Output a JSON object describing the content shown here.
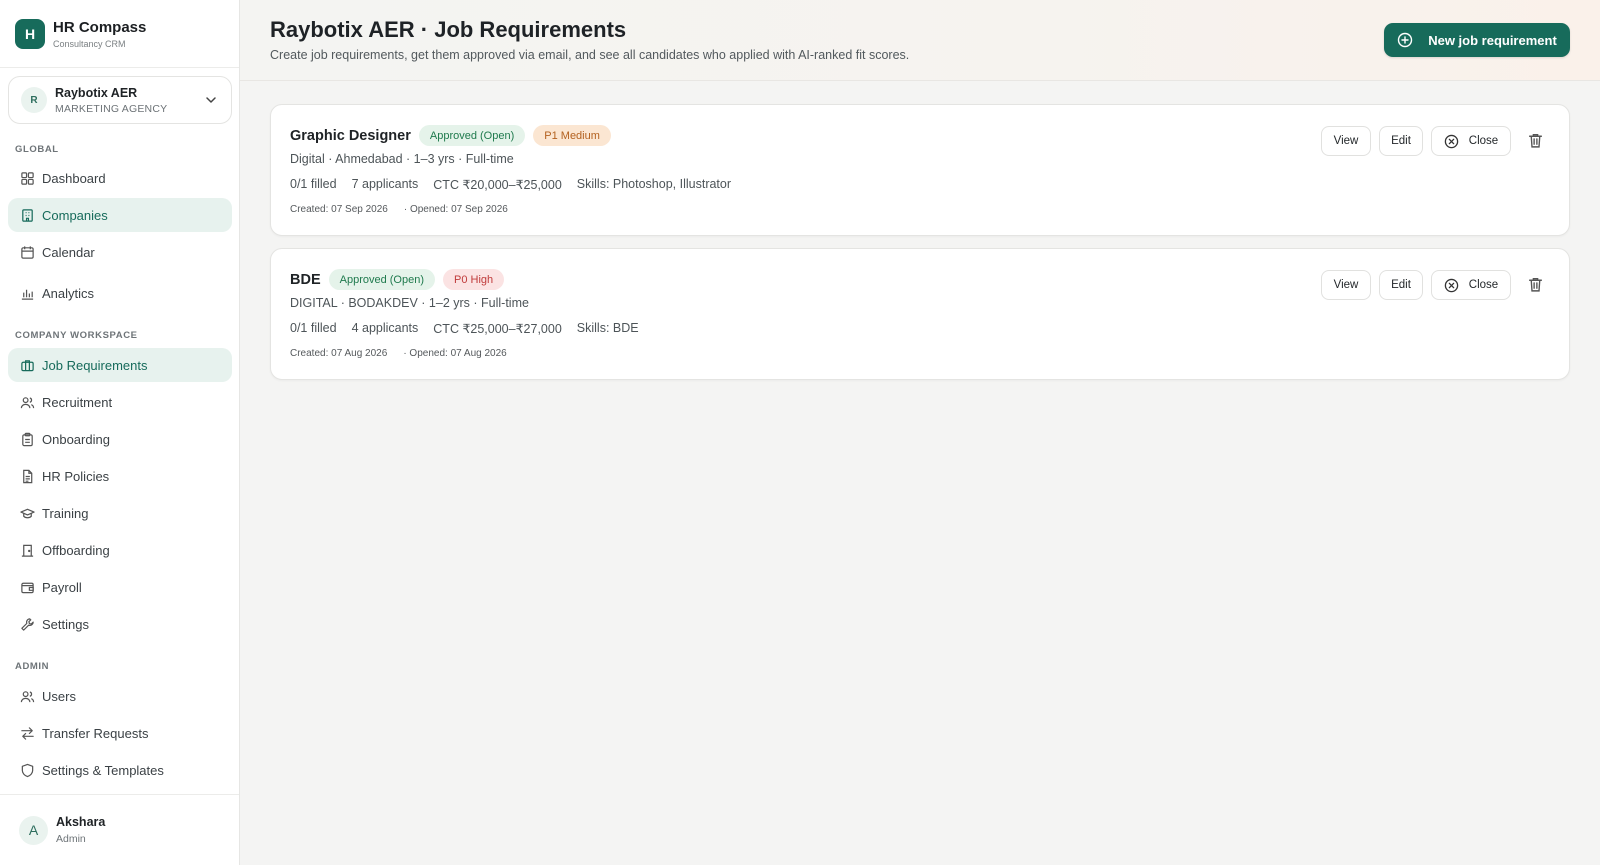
{
  "brand": {
    "logo_letter": "H",
    "name": "HR Compass",
    "subtitle": "Consultancy CRM"
  },
  "company_selector": {
    "avatar": "R",
    "name": "Raybotix AER",
    "type": "MARKETING AGENCY",
    "icon": "chevron-down-icon"
  },
  "sidebar": {
    "sections": {
      "global": "GLOBAL",
      "workspace": "COMPANY WORKSPACE",
      "admin": "ADMIN"
    },
    "global_items": [
      {
        "label": "Dashboard",
        "icon": "grid-icon"
      },
      {
        "label": "Companies",
        "icon": "building-icon",
        "active": true
      },
      {
        "label": "Calendar",
        "icon": "calendar-icon"
      },
      {
        "label": "Analytics",
        "icon": "bar-chart-icon"
      }
    ],
    "workspace_items": [
      {
        "label": "Job Requirements",
        "icon": "briefcase-icon",
        "active": true
      },
      {
        "label": "Recruitment",
        "icon": "users-icon"
      },
      {
        "label": "Onboarding",
        "icon": "clipboard-icon"
      },
      {
        "label": "HR Policies",
        "icon": "document-icon"
      },
      {
        "label": "Training",
        "icon": "graduation-cap-icon"
      },
      {
        "label": "Offboarding",
        "icon": "door-icon"
      },
      {
        "label": "Payroll",
        "icon": "wallet-icon"
      },
      {
        "label": "Settings",
        "icon": "wrench-icon"
      }
    ],
    "admin_items": [
      {
        "label": "Users",
        "icon": "users-icon"
      },
      {
        "label": "Transfer Requests",
        "icon": "transfer-arrows-icon"
      },
      {
        "label": "Settings & Templates",
        "icon": "shield-icon"
      }
    ]
  },
  "user": {
    "avatar": "A",
    "name": "Akshara",
    "role": "Admin"
  },
  "header": {
    "title": "Raybotix AER · Job Requirements",
    "subtitle": "Create job requirements, get them approved via email, and see all candidates who applied with AI-ranked fit scores.",
    "new_button": "New job requirement"
  },
  "actions": {
    "view": "View",
    "edit": "Edit",
    "close": "Close"
  },
  "jobs": [
    {
      "title": "Graphic Designer",
      "status": "Approved (Open)",
      "priority": "P1 Medium",
      "meta": "Digital · Ahmedabad · 1–3 yrs · Full-time",
      "filled": "0/1 filled",
      "applicants": "7 applicants",
      "ctc": "CTC ₹20,000–₹25,000",
      "skills": "Skills: Photoshop, Illustrator",
      "created": "Created: 07 Sep 2026",
      "opened": "· Opened: 07 Sep 2026"
    },
    {
      "title": "BDE",
      "status": "Approved (Open)",
      "priority": "P0 High",
      "meta": "DIGITAL · BODAKDEV · 1–2 yrs · Full-time",
      "filled": "0/1 filled",
      "applicants": "4 applicants",
      "ctc": "CTC ₹25,000–₹27,000",
      "skills": "Skills: BDE",
      "created": "Created: 07 Aug 2026",
      "opened": "· Opened: 07 Aug 2026"
    }
  ],
  "colors": {
    "accent": "#176b5b",
    "active_bg": "#e7f2ee",
    "approved": "#1f7a4d",
    "medium": "#b3611f",
    "high": "#c03b3b"
  }
}
